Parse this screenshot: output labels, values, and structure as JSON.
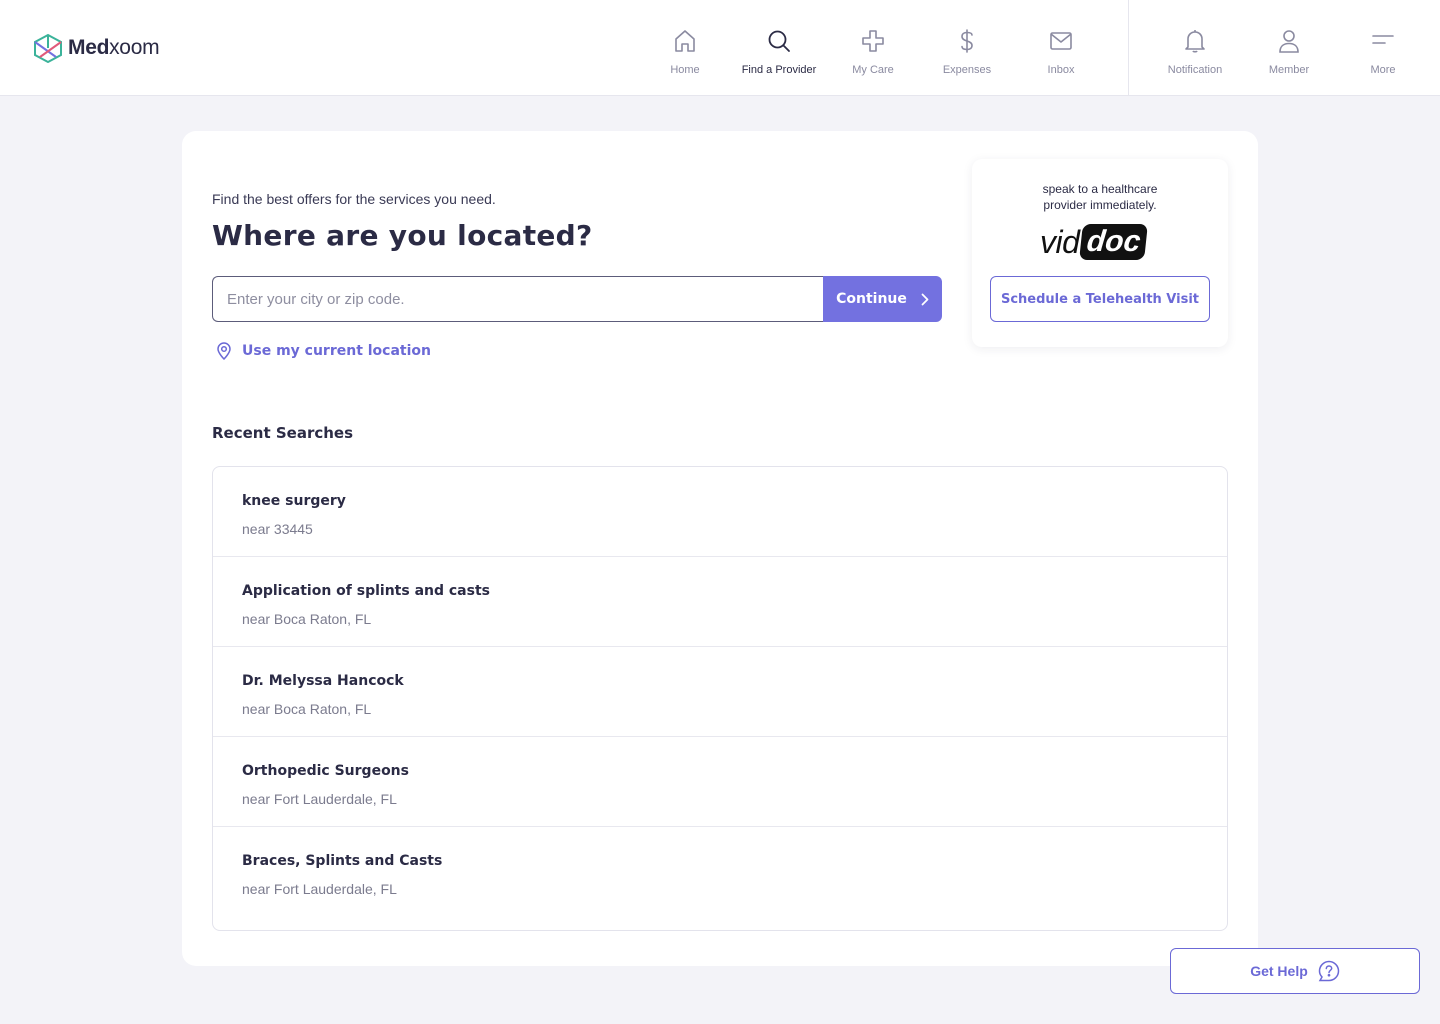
{
  "header": {
    "logo_bold": "Med",
    "logo_light": "xoom",
    "nav": [
      {
        "label": "Home",
        "icon": "home-icon"
      },
      {
        "label": "Find a Provider",
        "icon": "search-icon",
        "active": true
      },
      {
        "label": "My Care",
        "icon": "cross-icon"
      },
      {
        "label": "Expenses",
        "icon": "dollar-icon"
      },
      {
        "label": "Inbox",
        "icon": "mail-icon"
      },
      {
        "label": "Notification",
        "icon": "bell-icon"
      },
      {
        "label": "Member",
        "icon": "user-icon"
      },
      {
        "label": "More",
        "icon": "menu-icon"
      }
    ]
  },
  "main": {
    "subtitle": "Find the best offers for the services you need.",
    "headline": "Where are you located?",
    "search": {
      "placeholder": "Enter your city or zip code.",
      "value": "",
      "button_label": "Continue"
    },
    "location_link": "Use my current location"
  },
  "viddoc": {
    "text": "speak to a healthcare provider immediately.",
    "logo_part1": "vid",
    "logo_part2": "doc",
    "button_label": "Schedule a Telehealth Visit"
  },
  "recent": {
    "title": "Recent Searches",
    "items": [
      {
        "query": "knee surgery",
        "location": "near 33445"
      },
      {
        "query": "Application of splints and casts",
        "location": "near Boca Raton, FL"
      },
      {
        "query": "Dr. Melyssa Hancock",
        "location": "near Boca Raton, FL"
      },
      {
        "query": "Orthopedic Surgeons",
        "location": "near Fort Lauderdale, FL"
      },
      {
        "query": "Braces, Splints and Casts",
        "location": "near Fort Lauderdale, FL"
      }
    ]
  },
  "help": {
    "label": "Get Help"
  },
  "colors": {
    "accent": "#7371e0",
    "link": "#6b69d6",
    "text": "#2b2b45",
    "background": "#f3f3f8"
  }
}
